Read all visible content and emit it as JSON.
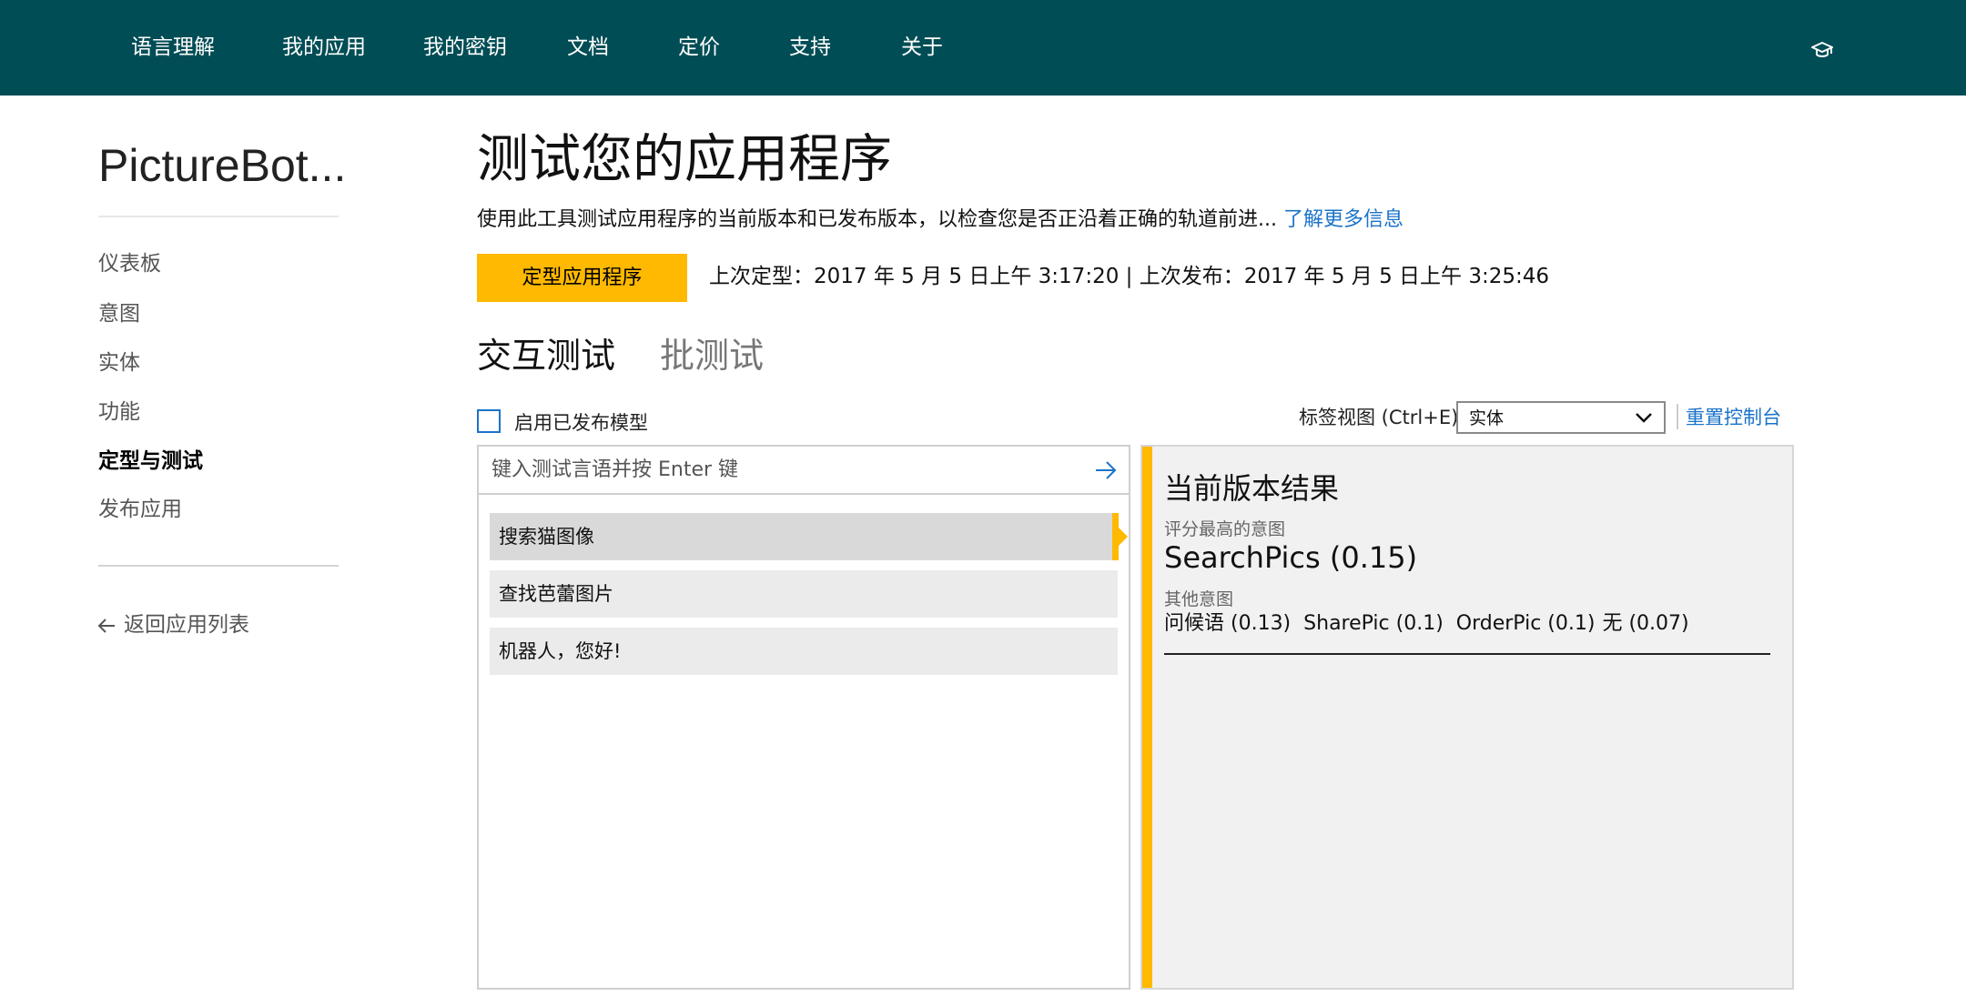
{
  "topnav": {
    "items": [
      "语言理解",
      "我的应用",
      "我的密钥",
      "文档",
      "定价",
      "支持",
      "关于"
    ],
    "icon": "graduation-cap-icon"
  },
  "sidebar": {
    "app_name": "PictureBot...",
    "items": [
      "仪表板",
      "意图",
      "实体",
      "功能",
      "定型与测试",
      "发布应用"
    ],
    "active_item": "定型与测试",
    "back_link": "返回应用列表"
  },
  "main": {
    "title": "测试您的应用程序",
    "description": "使用此工具测试应用程序的当前版本和已发布版本，以检查您是否正沿着正确的轨道前进...",
    "learn_more": "了解更多信息",
    "train_button": "定型应用程序",
    "train_meta": "上次定型：2017 年 5 月 5 日上午 3:17:20  |  上次发布：2017 年 5 月 5 日上午 3:25:46",
    "tabs": [
      "交互测试",
      "批测试"
    ],
    "active_tab": "交互测试",
    "published_checkbox_label": "启用已发布模型",
    "published_checkbox_checked": false,
    "tag_view_label": "标签视图 (Ctrl+E)",
    "tag_view_value": "实体",
    "reset_console": "重置控制台"
  },
  "test_panel": {
    "input_placeholder": "键入测试言语并按 Enter 键",
    "utterances": [
      "搜索猫图像",
      "查找芭蕾图片",
      "机器人，您好!"
    ],
    "selected_utterance": "搜索猫图像"
  },
  "result": {
    "title": "当前版本结果",
    "top_intent_label": "评分最高的意图",
    "top_intent": "SearchPics (0.15)",
    "other_intents_label": "其他意图",
    "other_intents": [
      "问候语 (0.13)",
      "SharePic (0.1)",
      "OrderPic (0.1)",
      "无 (0.07)"
    ]
  },
  "colors": {
    "nav_bg": "#014d55",
    "accent": "#ffb900",
    "link": "#1a73c9",
    "result_bg": "#f1f1f1"
  }
}
